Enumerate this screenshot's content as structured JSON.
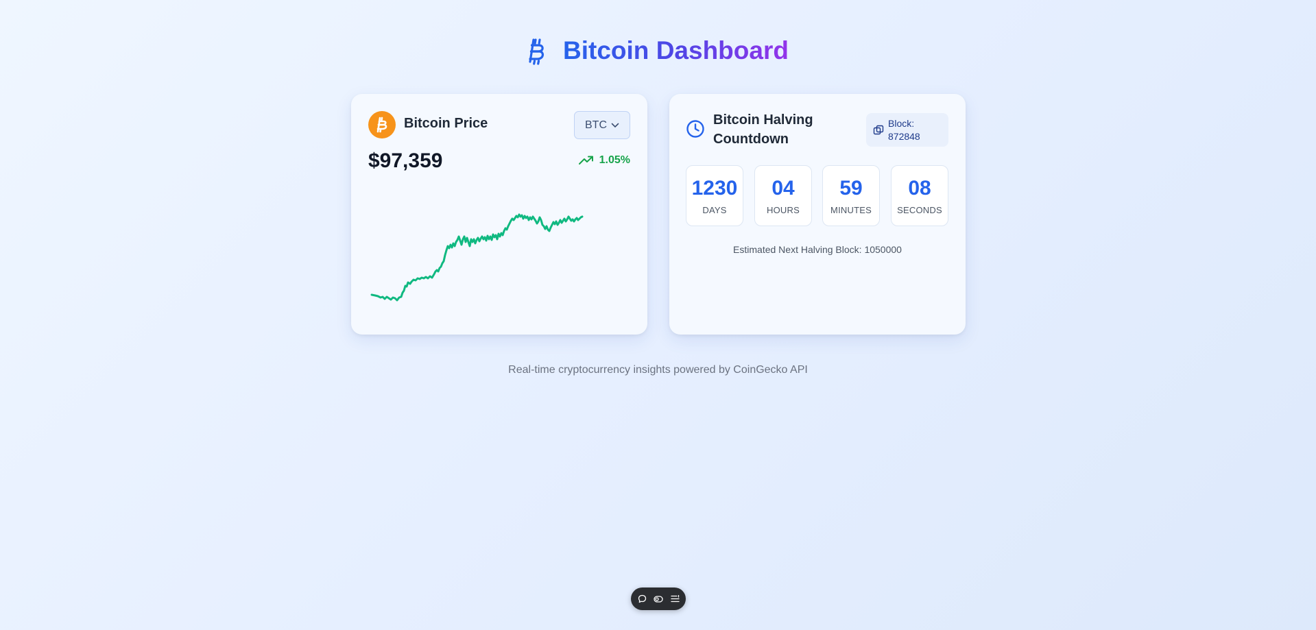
{
  "header": {
    "title": "Bitcoin Dashboard",
    "icon": "bitcoin-icon"
  },
  "price_card": {
    "title": "Bitcoin Price",
    "currency": "BTC",
    "price": "$97,359",
    "change": "1.05%",
    "change_direction": "up",
    "line_color": "#10b981"
  },
  "halving_card": {
    "title": "Bitcoin Halving Countdown",
    "block_label": "Block:",
    "block_value": "872848",
    "countdown": [
      {
        "value": "1230",
        "label": "DAYS"
      },
      {
        "value": "04",
        "label": "HOURS"
      },
      {
        "value": "59",
        "label": "MINUTES"
      },
      {
        "value": "08",
        "label": "SECONDS"
      }
    ],
    "estimate": "Estimated Next Halving Block: 1050000"
  },
  "footer": {
    "text": "Real-time cryptocurrency insights powered by CoinGecko API"
  },
  "toolbar": {
    "icons": [
      "comment-icon",
      "toggle-icon",
      "menu-icon"
    ]
  },
  "colors": {
    "accent": "#2563eb",
    "bitcoin": "#f7931a",
    "positive": "#16a34a"
  }
}
